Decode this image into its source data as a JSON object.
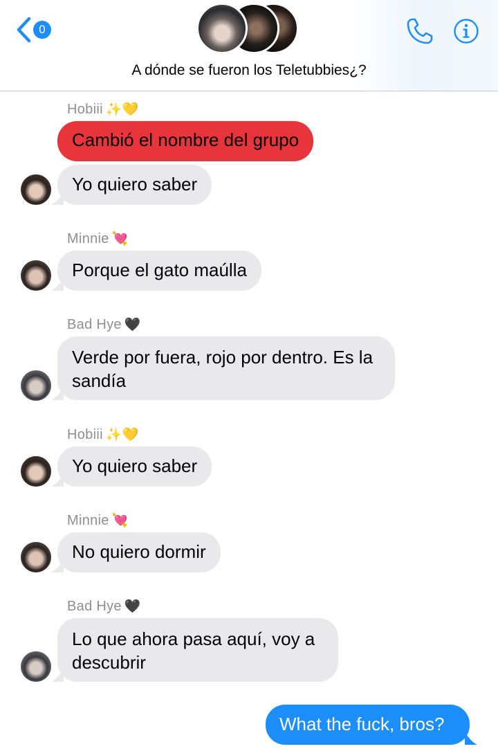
{
  "header": {
    "unread_count": "0",
    "group_name": "A dónde se fueron los Teletubbies¿?"
  },
  "messages": [
    {
      "sender": "Hobiii",
      "sender_emoji": "✨💛",
      "text": "Cambió el nombre del grupo"
    },
    {
      "text": "Yo quiero saber"
    },
    {
      "sender": "Minnie",
      "sender_emoji": "💘",
      "text": "Porque el gato maúlla"
    },
    {
      "sender": "Bad Hye",
      "sender_emoji": "🖤",
      "text_line1": "Verde por fuera, rojo por dentro. Es la",
      "text_line2": "sandía"
    },
    {
      "sender": "Hobiii",
      "sender_emoji": "✨💛",
      "text": "Yo quiero saber"
    },
    {
      "sender": "Minnie",
      "sender_emoji": "💘",
      "text": "No quiero dormir"
    },
    {
      "sender": "Bad Hye",
      "sender_emoji": "🖤",
      "text_line1": "Lo que ahora pasa aquí, voy a",
      "text_line2": "descubrir"
    },
    {
      "text": "What the fuck, bros?"
    }
  ],
  "colors": {
    "accent": "#1c8ef9",
    "incoming_bubble": "#e9e9eb",
    "highlight_bubble": "#e8353b",
    "sender_name": "#8e8e93"
  }
}
